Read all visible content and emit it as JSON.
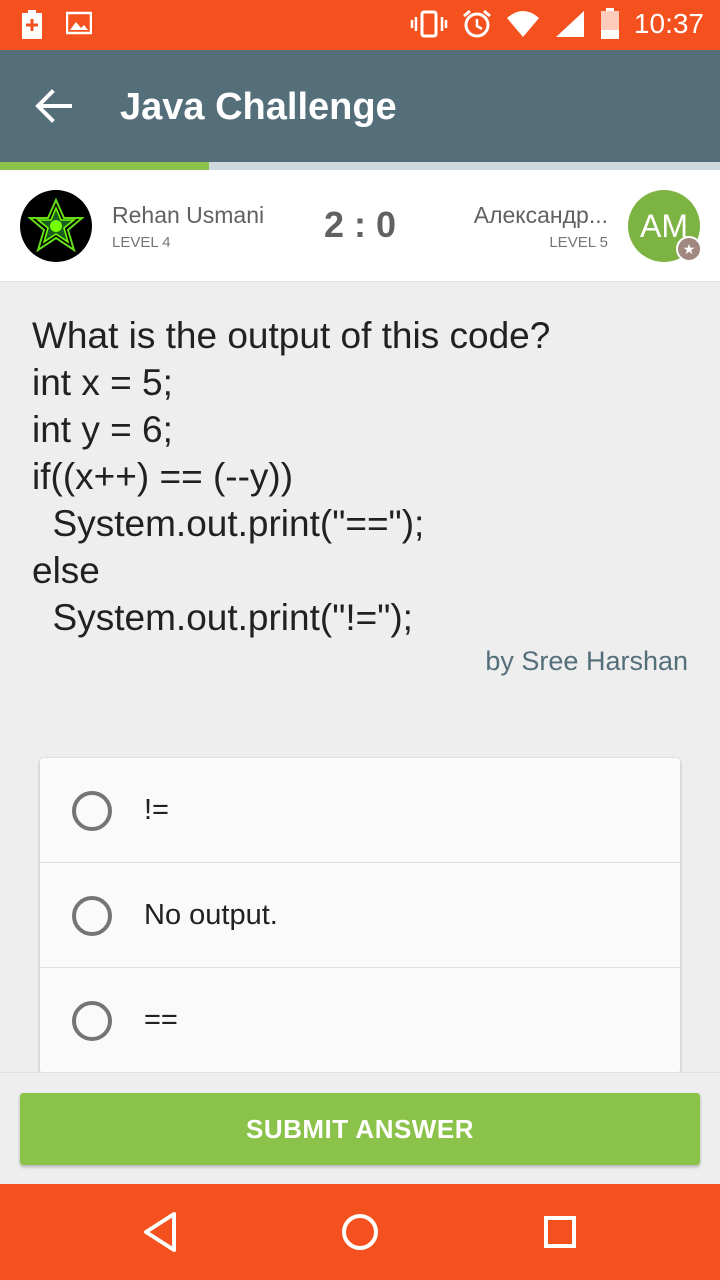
{
  "status_bar": {
    "time": "10:37",
    "icons": [
      "battery-saver-icon",
      "image-icon",
      "vibrate-icon",
      "alarm-icon",
      "wifi-icon",
      "signal-icon",
      "battery-icon"
    ]
  },
  "app_bar": {
    "title": "Java Challenge"
  },
  "progress": {
    "fraction": 0.29,
    "colors": {
      "fill": "#8bc34a",
      "track": "#cfd8dc"
    }
  },
  "players": {
    "player1": {
      "name": "Rehan Usmani",
      "level": "LEVEL 4"
    },
    "score": "2 : 0",
    "player2": {
      "name": "Александр...",
      "level": "LEVEL 5",
      "initials": "AM"
    }
  },
  "question": {
    "text": "What is the output of this code?\nint x = 5;\nint y = 6;\nif((x++) == (--y))\n  System.out.print(\"==\");\nelse\n  System.out.print(\"!=\");",
    "author": "by Sree Harshan"
  },
  "options": [
    {
      "label": "!=",
      "selected": false
    },
    {
      "label": "No output.",
      "selected": false
    },
    {
      "label": "==",
      "selected": false
    }
  ],
  "submit": {
    "label": "SUBMIT ANSWER"
  },
  "colors": {
    "status_bar": "#f4511e",
    "app_bar": "#546e7a",
    "accent_green": "#8bc34a",
    "nav_bar": "#f4511e"
  }
}
